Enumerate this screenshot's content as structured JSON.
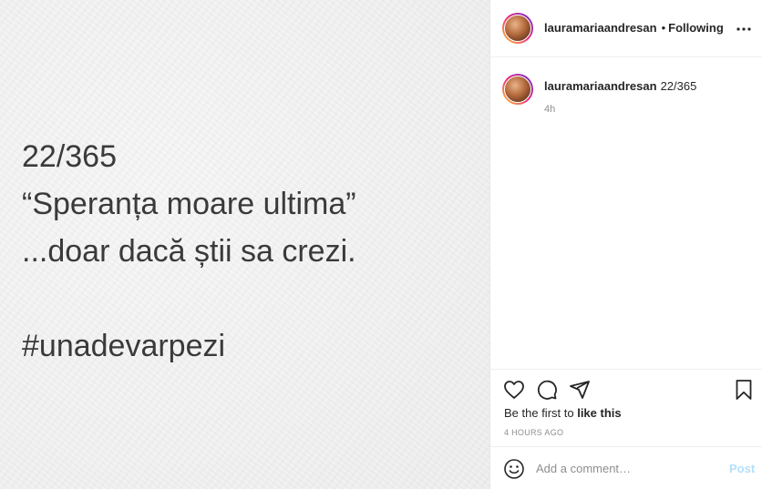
{
  "media": {
    "lines": [
      "22/365",
      "“Speranța moare ultima”",
      "...doar dacă știi sa crezi."
    ],
    "hashtag": "#unadevarpezi"
  },
  "header": {
    "username": "lauramariaandresan",
    "separator": "•",
    "follow_status": "Following",
    "more_icon": "more-horizontal-icon"
  },
  "caption": {
    "username": "lauramariaandresan",
    "text": "22/365",
    "time": "4h"
  },
  "actions": {
    "icons": [
      "heart-icon",
      "comment-icon",
      "share-icon",
      "bookmark-icon"
    ],
    "likes_prefix": "Be the first to ",
    "likes_bold": "like this",
    "timestamp": "4 HOURS AGO"
  },
  "comment": {
    "placeholder": "Add a comment…",
    "post_label": "Post",
    "emoji_icon": "emoji-icon"
  },
  "colors": {
    "text": "#262626",
    "muted": "#8e8e8e",
    "post_disabled": "#b2dffc",
    "media_text": "#3a3a3a"
  }
}
